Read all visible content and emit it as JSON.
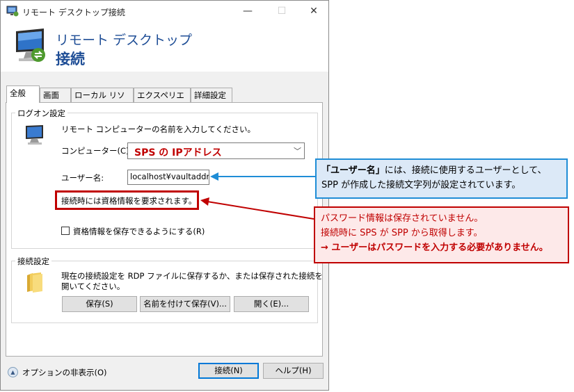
{
  "window": {
    "title": "リモート デスクトップ接続",
    "controls": {
      "minimize": "—",
      "maximize": "☐",
      "close": "✕"
    }
  },
  "banner": {
    "line1": "リモート デスクトップ",
    "line2": "接続"
  },
  "tabs": [
    {
      "label": "全般",
      "active": true
    },
    {
      "label": "画面"
    },
    {
      "label": "ローカル リソース"
    },
    {
      "label": "エクスペリエンス"
    },
    {
      "label": "詳細設定"
    }
  ],
  "logon": {
    "group_label": "ログオン設定",
    "instruction": "リモート コンピューターの名前を入力してください。",
    "computer_label": "コンピューター(C):",
    "computer_value": "SPS の IPアドレス",
    "username_label": "ユーザー名:",
    "username_value": "localhost¥vaultaddress",
    "credential_notice": "接続時には資格情報を要求されます。",
    "save_credentials_label": "資格情報を保存できるようにする(R)",
    "save_credentials_checked": false
  },
  "connection": {
    "group_label": "接続設定",
    "description_line1": "現在の接続設定を RDP ファイルに保存するか、または保存された接続を",
    "description_line2": "開いてください。",
    "save_button": "保存(S)",
    "save_as_button": "名前を付けて保存(V)...",
    "open_button": "開く(E)..."
  },
  "footer": {
    "options_label": "オプションの非表示(O)",
    "connect_button": "接続(N)",
    "help_button": "ヘルプ(H)"
  },
  "callouts": {
    "username": {
      "emphasis": "「ユーザー名」",
      "line1_rest": "には、接続に使用するユーザーとして、",
      "line2": "SPP が作成した接続文字列が設定されています。"
    },
    "password": {
      "line1": "パスワード情報は保存されていません。",
      "line2": "接続時に SPS が SPP から取得します。",
      "line3": "→ ユーザーはパスワードを入力する必要がありません。"
    }
  },
  "colors": {
    "accent_blue": "#1f8dd6",
    "accent_red": "#c00000",
    "banner_text": "#1f4e96"
  }
}
